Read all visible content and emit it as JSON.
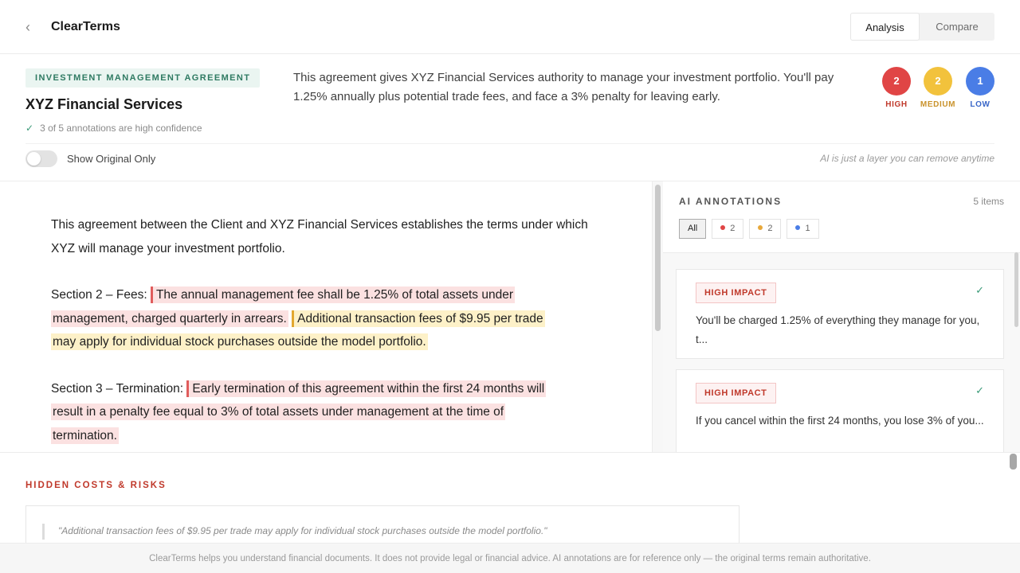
{
  "header": {
    "brand": "ClearTerms",
    "tabs": [
      "Analysis",
      "Compare"
    ]
  },
  "summary": {
    "doc_type": "INVESTMENT MANAGEMENT AGREEMENT",
    "company": "XYZ Financial Services",
    "confidence": "3 of 5 annotations are high confidence",
    "text": "This agreement gives XYZ Financial Services authority to manage your investment portfolio. You'll pay 1.25% annually plus potential trade fees, and face a 3% penalty for leaving early.",
    "severity": [
      {
        "count": "2",
        "label": "HIGH",
        "color": "#e04545"
      },
      {
        "count": "2",
        "label": "MEDIUM",
        "color": "#f2c23c"
      },
      {
        "count": "1",
        "label": "LOW",
        "color": "#4a7de6"
      }
    ],
    "toggle_label": "Show Original Only",
    "ai_note": "AI is just a layer you can remove anytime"
  },
  "document": {
    "intro": "This agreement between the Client and XYZ Financial Services establishes the terms under which XYZ will manage your investment portfolio.",
    "s2_label": "Section 2 – Fees: ",
    "s2_high_a": "The annual management fee shall be 1.25% of total assets under",
    "s2_high_b": "management, charged quarterly in arrears.",
    "s2_med_a": "Additional transaction fees of $9.95 per trade",
    "s2_med_b": "may apply for individual stock purchases outside the model portfolio.",
    "s3_label": "Section 3 – Termination: ",
    "s3_high_a": "Early termination of this agreement within the first 24 months will",
    "s3_high_b": "result in a penalty fee equal to 3% of total assets under management at the time of",
    "s3_high_c": "termination."
  },
  "annotations": {
    "title": "AI ANNOTATIONS",
    "count": "5 items",
    "filters": [
      {
        "label": "All"
      },
      {
        "label": "2",
        "color": "#e04545"
      },
      {
        "label": "2",
        "color": "#e8a83a"
      },
      {
        "label": "1",
        "color": "#4a7de6"
      }
    ],
    "cards": [
      {
        "badge": "HIGH IMPACT",
        "text": "You'll be charged 1.25% of everything they manage for you, t..."
      },
      {
        "badge": "HIGH IMPACT",
        "text": "If you cancel within the first 24 months, you lose 3% of you..."
      }
    ]
  },
  "hidden": {
    "title": "HIDDEN COSTS & RISKS",
    "quote": "\"Additional transaction fees of $9.95 per trade may apply for individual stock purchases outside the model portfolio.\""
  },
  "footer": "ClearTerms helps you understand financial documents. It does not provide legal or financial advice. AI annotations are for reference only — the original terms remain authoritative."
}
